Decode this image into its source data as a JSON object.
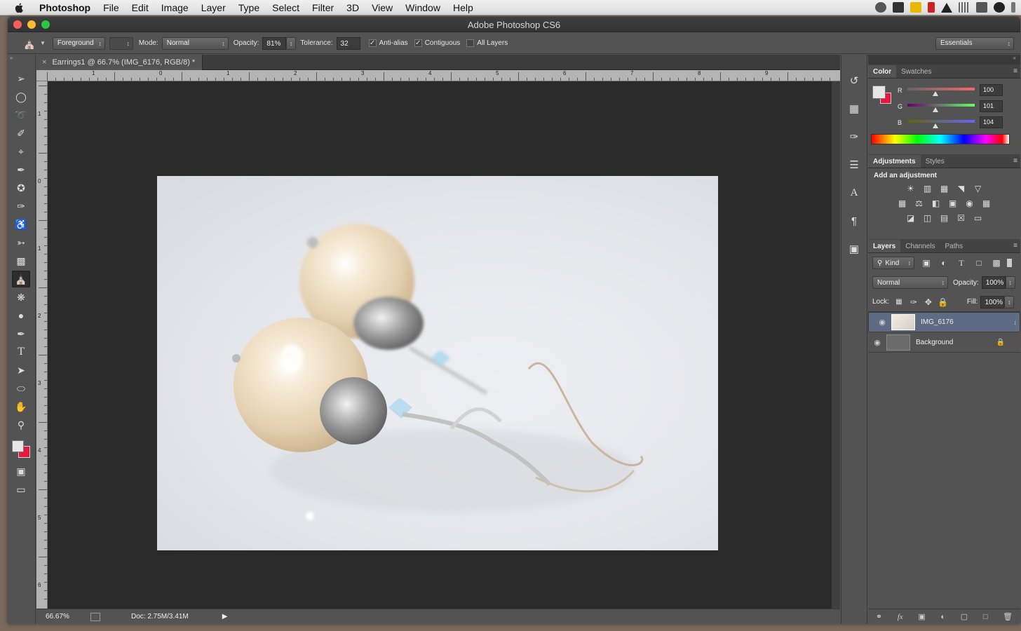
{
  "menubar": {
    "app": "Photoshop",
    "items": [
      "File",
      "Edit",
      "Image",
      "Layer",
      "Type",
      "Select",
      "Filter",
      "3D",
      "View",
      "Window",
      "Help"
    ]
  },
  "window": {
    "title": "Adobe Photoshop CS6"
  },
  "options": {
    "fill_source": "Foreground",
    "mode_label": "Mode:",
    "mode_value": "Normal",
    "opacity_label": "Opacity:",
    "opacity_value": "81%",
    "tolerance_label": "Tolerance:",
    "tolerance_value": "32",
    "antialias_label": "Anti-alias",
    "antialias_checked": true,
    "contiguous_label": "Contiguous",
    "contiguous_checked": true,
    "all_layers_label": "All Layers",
    "all_layers_checked": false,
    "workspace": "Essentials"
  },
  "document": {
    "tab_title": "Earrings1 @ 66.7% (IMG_6176, RGB/8) *",
    "ruler_h": [
      "1",
      "0",
      "1",
      "2",
      "3",
      "4",
      "5",
      "6",
      "7",
      "8",
      "9"
    ],
    "ruler_v": [
      "1",
      "0",
      "1",
      "2",
      "3",
      "4",
      "5",
      "6"
    ],
    "zoom": "66.67%",
    "doc_size": "Doc: 2.75M/3.41M"
  },
  "tools": [
    "move",
    "marquee",
    "lasso",
    "quick-select",
    "crop",
    "eyedropper",
    "healing",
    "brush",
    "stamp",
    "history-brush",
    "eraser",
    "paint-bucket",
    "blur",
    "dodge",
    "pen",
    "type",
    "path-select",
    "ellipse",
    "hand",
    "zoom"
  ],
  "active_tool": "paint-bucket",
  "colors": {
    "foreground": "#e6e6e6",
    "background": "#e8173d",
    "accent": "#5e6b82"
  },
  "color_panel": {
    "tabs": [
      "Color",
      "Swatches"
    ],
    "r_label": "R",
    "r": "100",
    "g_label": "G",
    "g": "101",
    "b_label": "B",
    "b": "104"
  },
  "adjustments_panel": {
    "tabs": [
      "Adjustments",
      "Styles"
    ],
    "heading": "Add an adjustment"
  },
  "layers_panel": {
    "tabs": [
      "Layers",
      "Channels",
      "Paths"
    ],
    "filter": "Kind",
    "blend_mode": "Normal",
    "opacity_label": "Opacity:",
    "opacity": "100%",
    "lock_label": "Lock:",
    "fill_label": "Fill:",
    "fill": "100%",
    "layers": [
      {
        "name": "IMG_6176",
        "selected": true
      },
      {
        "name": "Background",
        "locked": true
      }
    ]
  }
}
